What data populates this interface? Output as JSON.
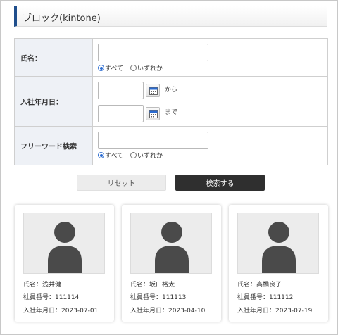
{
  "header": {
    "title": "ブロック(kintone)"
  },
  "search": {
    "name": {
      "label": "氏名：",
      "value": "",
      "radio_all": "すべて",
      "radio_any": "いずれか",
      "selected": "all"
    },
    "hire_date": {
      "label": "入社年月日：",
      "from_value": "",
      "to_value": "",
      "from_suffix": "から",
      "to_suffix": "まで"
    },
    "freeword": {
      "label": "フリーワード検索",
      "value": "",
      "radio_all": "すべて",
      "radio_any": "いずれか",
      "selected": "all"
    }
  },
  "buttons": {
    "reset": "リセット",
    "search": "検索する"
  },
  "cards": [
    {
      "name": "氏名：浅井健一",
      "employee_no": "社員番号：111114",
      "hire_date": "入社年月日：2023-07-01"
    },
    {
      "name": "氏名：坂口裕太",
      "employee_no": "社員番号：111113",
      "hire_date": "入社年月日：2023-04-10"
    },
    {
      "name": "氏名：高橋良子",
      "employee_no": "社員番号：111112",
      "hire_date": "入社年月日：2023-07-19"
    }
  ],
  "colors": {
    "accent": "#1f4e8c",
    "label_bg": "#eef1f6",
    "search_button": "#2f2f2f",
    "avatar": "#4a4a4a"
  }
}
